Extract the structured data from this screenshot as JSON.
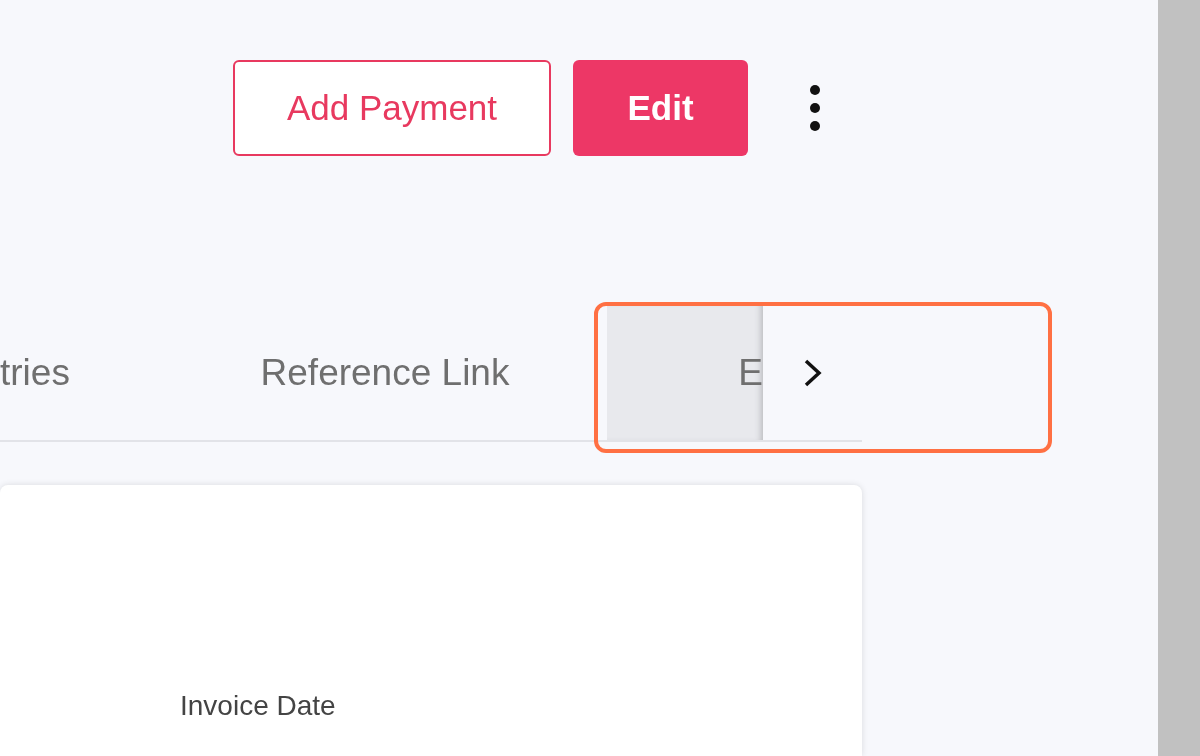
{
  "header": {
    "buttons": [
      {
        "label": "Add Payment",
        "kind": "outline"
      },
      {
        "label": "Edit",
        "kind": "filled"
      }
    ]
  },
  "tabs": [
    {
      "label": "tries",
      "selected": false
    },
    {
      "label": "Reference Link",
      "selected": false
    },
    {
      "label": "E",
      "selected": true
    }
  ],
  "card": {
    "field_label": "Invoice Date"
  }
}
